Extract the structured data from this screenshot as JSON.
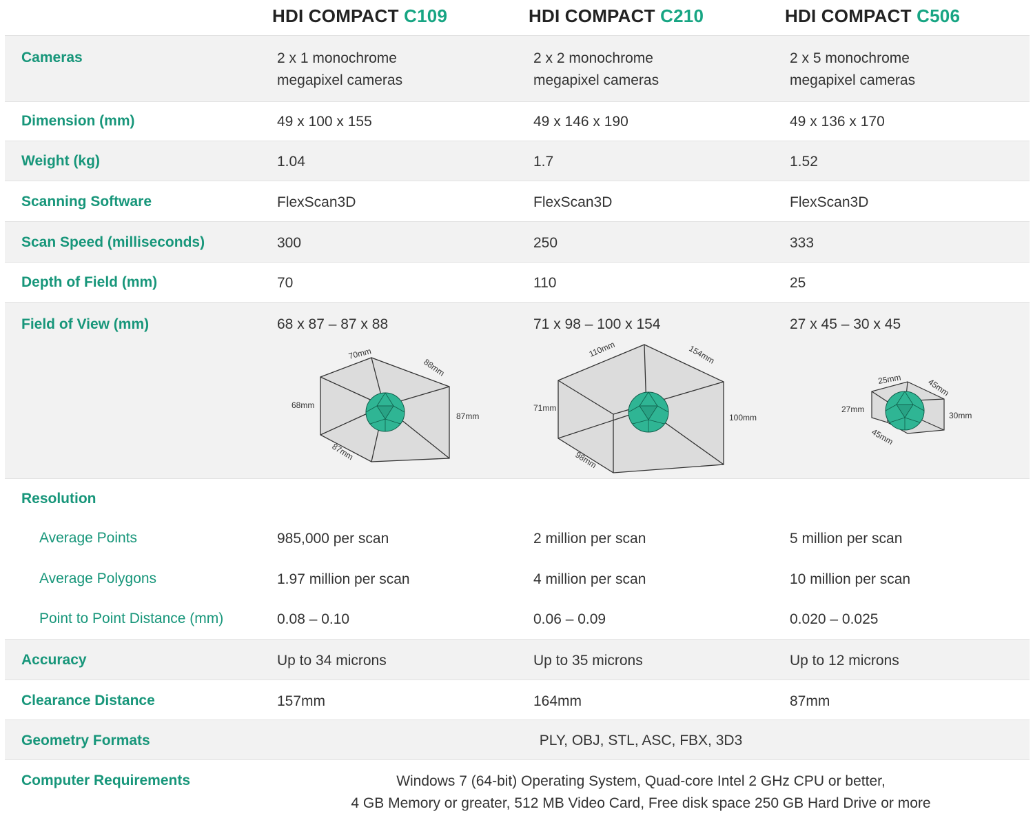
{
  "header": {
    "models": [
      {
        "prefix": "HDI COMPACT",
        "code": "C109"
      },
      {
        "prefix": "HDI COMPACT",
        "code": "C210"
      },
      {
        "prefix": "HDI COMPACT",
        "code": "C506"
      }
    ]
  },
  "rows": {
    "cameras": {
      "label": "Cameras",
      "values": [
        [
          "2 x 1 monochrome",
          "megapixel cameras"
        ],
        [
          "2 x 2 monochrome",
          "megapixel cameras"
        ],
        [
          "2 x 5 monochrome",
          "megapixel cameras"
        ]
      ]
    },
    "dimension": {
      "label": "Dimension (mm)",
      "values": [
        "49 x 100 x 155",
        "49 x 146 x 190",
        "49 x 136 x 170"
      ]
    },
    "weight": {
      "label": "Weight (kg)",
      "values": [
        "1.04",
        "1.7",
        "1.52"
      ]
    },
    "software": {
      "label": "Scanning Software",
      "values": [
        "FlexScan3D",
        "FlexScan3D",
        "FlexScan3D"
      ]
    },
    "speed": {
      "label": "Scan Speed (milliseconds)",
      "values": [
        "300",
        "250",
        "333"
      ]
    },
    "depth": {
      "label": "Depth of Field (mm)",
      "values": [
        "70",
        "110",
        "25"
      ]
    },
    "fov": {
      "label": "Field of View (mm)",
      "values": [
        "68 x 87 – 87 x 88",
        "71 x 98 – 100 x 154",
        "27 x 45 – 30 x 45"
      ]
    },
    "resolution": {
      "label": "Resolution"
    },
    "avg_points": {
      "label": "Average Points",
      "values": [
        "985,000 per scan",
        "2 million per scan",
        "5 million per scan"
      ]
    },
    "avg_polygons": {
      "label": "Average Polygons",
      "values": [
        "1.97 million per scan",
        "4 million per scan",
        "10 million per scan"
      ]
    },
    "p2p": {
      "label": "Point to Point Distance (mm)",
      "values": [
        "0.08 – 0.10",
        "0.06 – 0.09",
        "0.020 – 0.025"
      ]
    },
    "accuracy": {
      "label": "Accuracy",
      "values": [
        "Up to 34 microns",
        "Up to 35 microns",
        "Up to 12 microns"
      ]
    },
    "clearance": {
      "label": "Clearance Distance",
      "values": [
        "157mm",
        "164mm",
        "87mm"
      ]
    },
    "formats": {
      "label": "Geometry Formats",
      "value": "PLY, OBJ, STL, ASC, FBX, 3D3"
    },
    "computer": {
      "label": "Computer Requirements",
      "lines": [
        "Windows 7 (64-bit) Operating System, Quad-core Intel 2 GHz CPU or better,",
        "4 GB Memory or greater, 512 MB Video Card, Free disk space 250 GB Hard Drive or more"
      ]
    }
  },
  "diagrams": {
    "c109": {
      "top_left": "70mm",
      "top_right": "88mm",
      "left": "68mm",
      "right": "87mm",
      "bottom": "87mm"
    },
    "c210": {
      "top_left": "110mm",
      "top_right": "154mm",
      "left": "71mm",
      "right": "100mm",
      "bottom": "98mm"
    },
    "c506": {
      "top_left": "25mm",
      "top_right": "45mm",
      "left": "27mm",
      "right": "30mm",
      "bottom": "45mm"
    }
  },
  "colors": {
    "accent": "#17967a",
    "sphere": "#2fb594",
    "shade": "#f2f2f2",
    "box": "#dcdcdc"
  }
}
